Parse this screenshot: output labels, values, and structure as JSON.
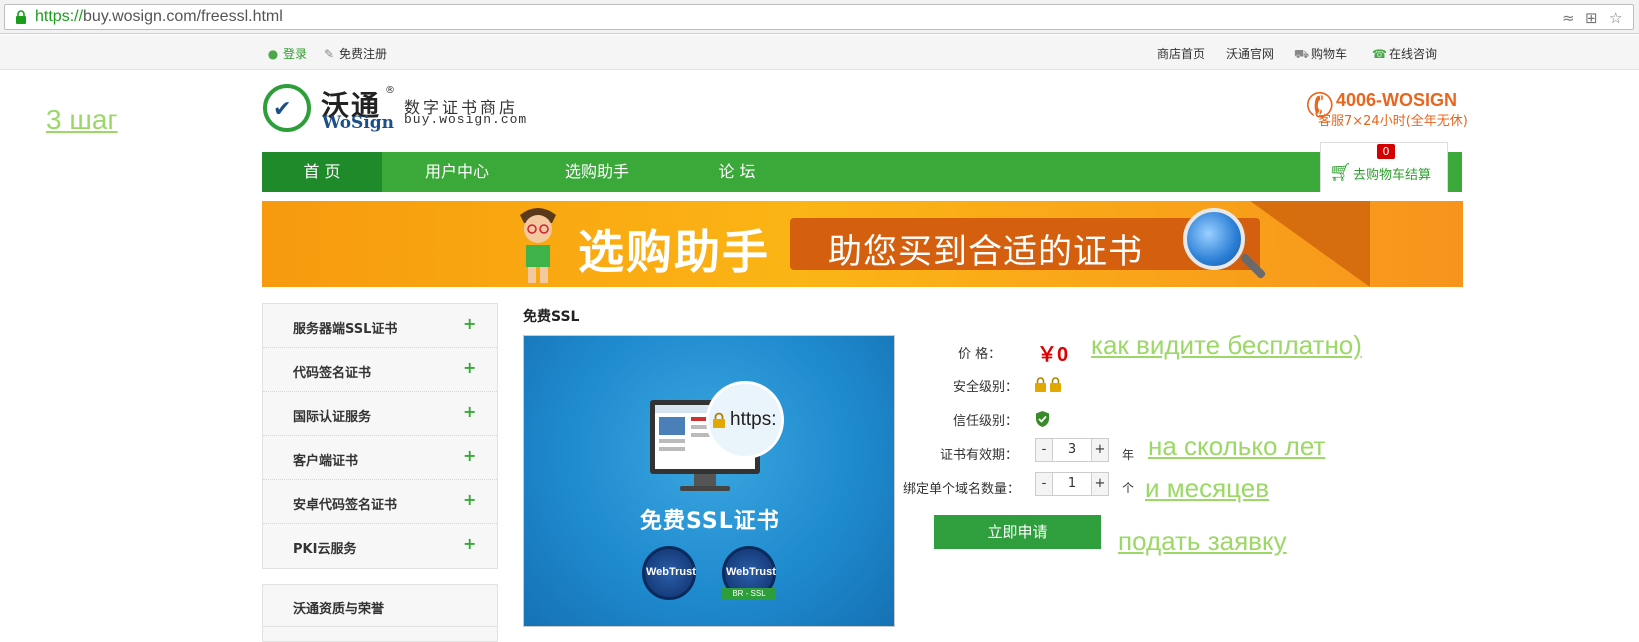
{
  "browser": {
    "url_scheme": "https://",
    "url_rest": "buy.wosign.com/freessl.html"
  },
  "topbar": {
    "login": "登录",
    "register": "免费注册",
    "links": [
      "商店首页",
      "沃通官网",
      "购物车",
      "在线咨询"
    ]
  },
  "header": {
    "logo_cn": "沃通",
    "logo_reg": "®",
    "logo_en_wo": "Wo",
    "logo_en_sign": "Sign",
    "store_cn": "数字证书商店",
    "store_en": "buy.wosign.com",
    "phone": "4006-WOSIGN",
    "service": "客服7×24小时(全年无休)"
  },
  "nav": {
    "items": [
      "首 页",
      "用户中心",
      "选购助手",
      "论 坛"
    ],
    "cart_count": "0",
    "cart_label": "去购物车结算"
  },
  "banner": {
    "title": "选购助手",
    "subtitle": "助您买到合适的证书"
  },
  "sidebar": {
    "items": [
      "服务器端SSL证书",
      "代码签名证书",
      "国际认证服务",
      "客户端证书",
      "安卓代码签名证书",
      "PKI云服务"
    ],
    "plus": "+",
    "honor": "沃通资质与荣誉"
  },
  "product": {
    "title": "免费SSL",
    "image_text": "免费SSL证书",
    "image_https": "https:",
    "seal1": "WebTrust",
    "seal2": "WebTrust",
    "seal2_ribbon": "BR - SSL"
  },
  "details": {
    "price_label": "价 格：",
    "price_value": "￥0",
    "security_label": "安全级别：",
    "trust_label": "信任级别：",
    "validity_label": "证书有效期：",
    "validity_value": "3",
    "validity_unit": "年",
    "domains_label": "绑定单个域名数量：",
    "domains_value": "1",
    "domains_unit": "个",
    "minus": "-",
    "plus": "+",
    "apply": "立即申请"
  },
  "annotations": {
    "step": "3 шаг",
    "free": "как видите бесплатно)",
    "years": "на сколько лет",
    "months": "и месяцев",
    "submit": "подать заявку"
  },
  "colors": {
    "brand_green": "#3aa93a",
    "nav_active": "#1f8a2a",
    "price_red": "#e00000",
    "phone_orange": "#e8661e",
    "annotation_green": "#9bd866"
  }
}
